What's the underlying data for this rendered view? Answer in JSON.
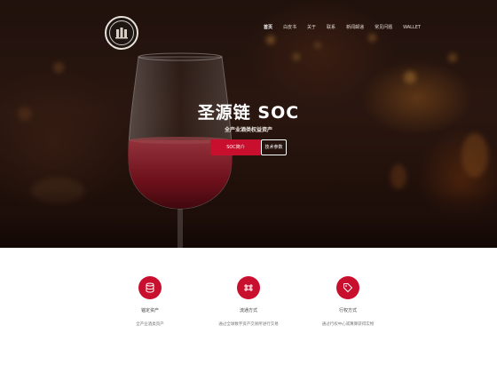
{
  "nav": {
    "items": [
      {
        "label": "首页",
        "active": true
      },
      {
        "label": "白皮书",
        "active": false
      },
      {
        "label": "关于",
        "active": false
      },
      {
        "label": "联系",
        "active": false
      },
      {
        "label": "新闻邮递",
        "active": false
      },
      {
        "label": "常见问题",
        "active": false
      },
      {
        "label": "WALLET",
        "active": false
      }
    ]
  },
  "hero": {
    "title": "圣源链 SOC",
    "subtitle": "全产业酒类权益资产",
    "primary_button": "SOC简介",
    "secondary_button": "技术参数"
  },
  "features": [
    {
      "icon": "database-icon",
      "title": "锚定资产",
      "desc": "全产业酒类资产"
    },
    {
      "icon": "command-icon",
      "title": "流通方式",
      "desc": "通过全球数字资产交易所进行交易"
    },
    {
      "icon": "tag-icon",
      "title": "行权方式",
      "desc": "通过行权中心或算算获得实物"
    }
  ],
  "colors": {
    "accent": "#c8102e",
    "hero_dark": "#2a1812"
  }
}
